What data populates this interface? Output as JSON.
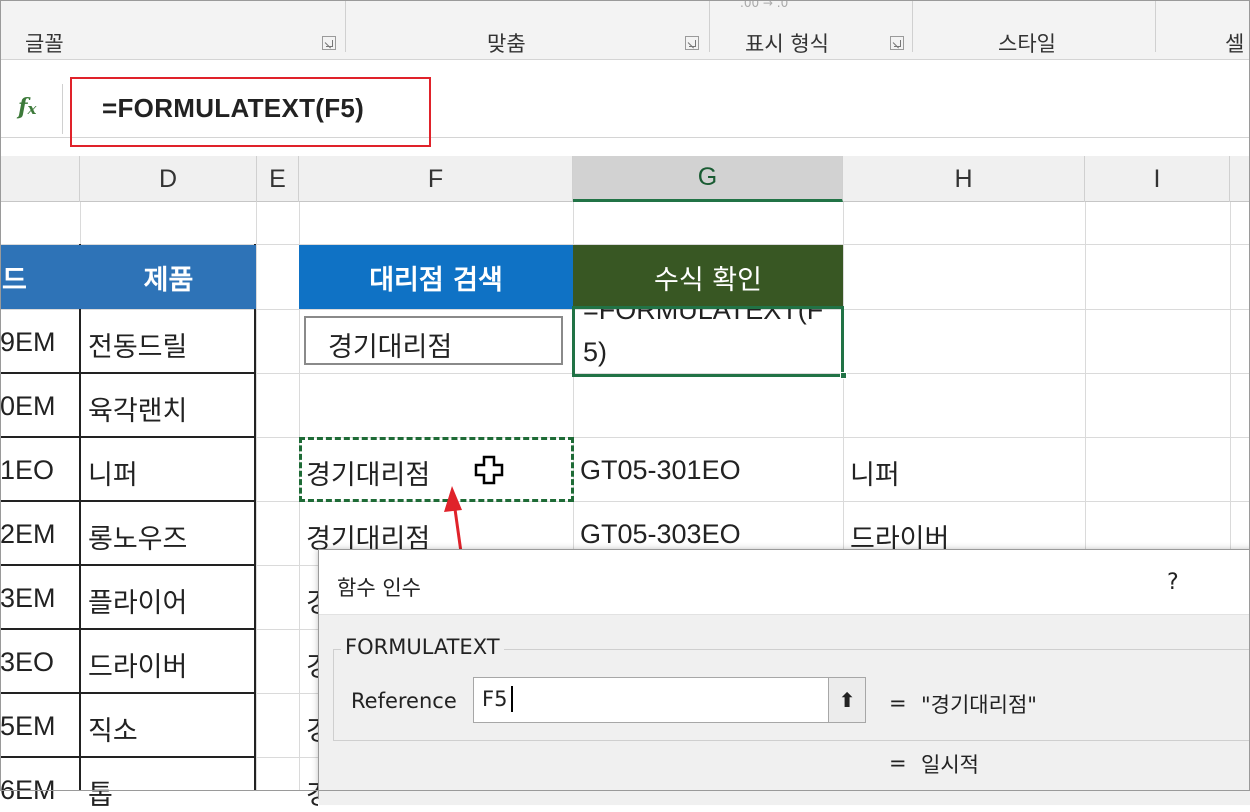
{
  "ribbon": {
    "groups": [
      "글꼴",
      "맞춤",
      "표시 형식",
      "스타일",
      "셀"
    ],
    "faint_glyphs": ".00 → .0"
  },
  "formula_bar": {
    "fx": "fx",
    "formula": "=FORMULATEXT(F5)"
  },
  "columns": [
    "D",
    "E",
    "F",
    "G",
    "H",
    "I"
  ],
  "table": {
    "header_c": "드",
    "header_d": "제품",
    "rows": [
      {
        "code": "9EM",
        "product": "전동드릴"
      },
      {
        "code": "0EM",
        "product": "육각랜치"
      },
      {
        "code": "1EO",
        "product": "니퍼"
      },
      {
        "code": "2EM",
        "product": "롱노우즈"
      },
      {
        "code": "3EM",
        "product": "플라이어"
      },
      {
        "code": "3EO",
        "product": "드라이버"
      },
      {
        "code": "5EM",
        "product": "직소"
      },
      {
        "code": "6EM",
        "product": "톱"
      }
    ]
  },
  "search_box": {
    "header": "대리점 검색",
    "value": "경기대리점"
  },
  "formula_check": {
    "header": "수식 확인",
    "line1": "=FORMULATEXT(F",
    "line2": "5)"
  },
  "result_rows": [
    {
      "f": "경기대리점",
      "g": "GT05-301EO",
      "h": "니퍼"
    },
    {
      "f": "경기대리점",
      "g": "GT05-303EO",
      "h": "드라이버"
    }
  ],
  "f_col_partial": [
    "경",
    "경",
    "경",
    "경"
  ],
  "dialog": {
    "title": "함수 인수",
    "help": "?",
    "function_name": "FORMULATEXT",
    "ref_label": "Reference",
    "ref_value": "F5",
    "collapse_icon": "⬆",
    "eq": "=",
    "result1": "\"경기대리점\"",
    "result2": "일시적"
  },
  "colors": {
    "blue_header": "#2e73b7",
    "search_header": "#0f72c5",
    "green_header": "#385723",
    "selection_green": "#217346",
    "marquee": "#1e6b36",
    "highlight_red": "#e0222a"
  }
}
